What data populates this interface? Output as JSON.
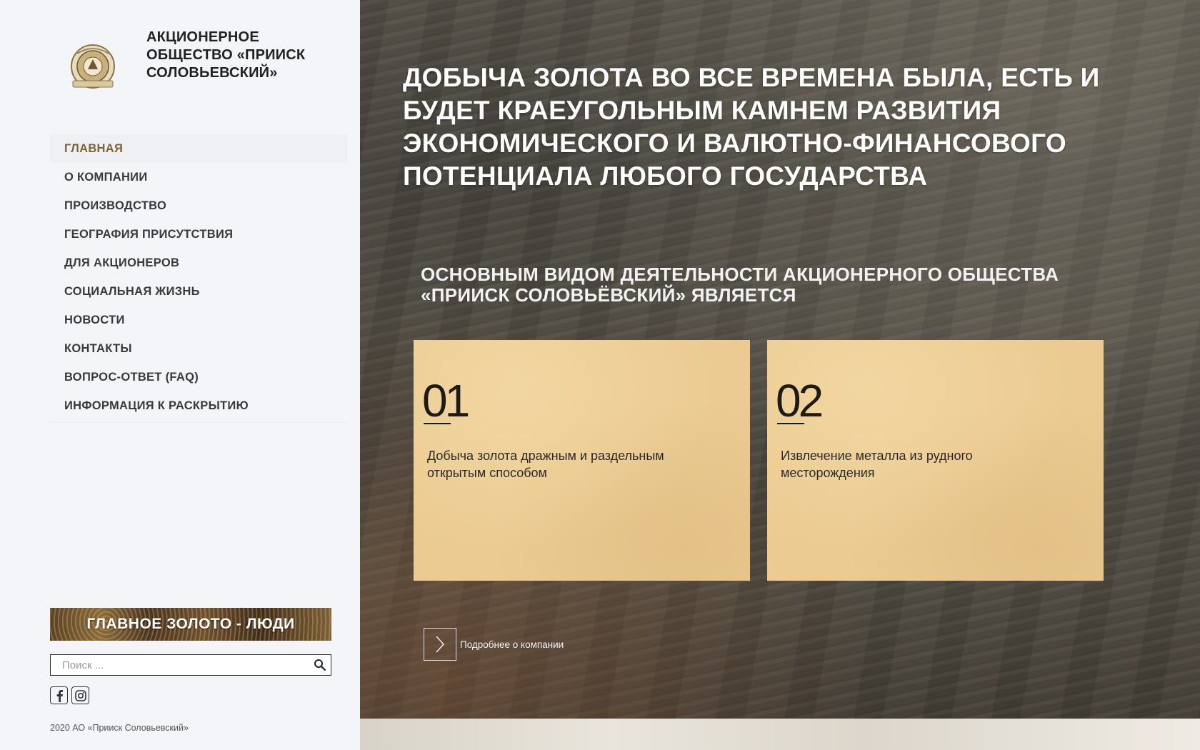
{
  "brand": {
    "title": "АКЦИОНЕРНОЕ ОБЩЕСТВО «ПРИИСК СОЛОВЬЕВСКИЙ»",
    "logo_icon": "company-emblem-icon"
  },
  "nav": {
    "items": [
      {
        "label": "ГЛАВНАЯ",
        "active": true
      },
      {
        "label": "О КОМПАНИИ"
      },
      {
        "label": "ПРОИЗВОДСТВО"
      },
      {
        "label": "ГЕОГРАФИЯ ПРИСУТСТВИЯ"
      },
      {
        "label": "ДЛЯ АКЦИОНЕРОВ"
      },
      {
        "label": "СОЦИАЛЬНАЯ ЖИЗНЬ"
      },
      {
        "label": "НОВОСТИ"
      },
      {
        "label": "КОНТАКТЫ"
      },
      {
        "label": "ВОПРОС-ОТВЕТ (FAQ)"
      },
      {
        "label": "ИНФОРМАЦИЯ К РАСКРЫТИЮ"
      }
    ]
  },
  "banner": {
    "label": "ГЛАВНОЕ ЗОЛОТО - ЛЮДИ"
  },
  "search": {
    "placeholder": "Поиск ...",
    "value": "",
    "icon": "search-icon"
  },
  "socials": [
    {
      "name": "facebook",
      "icon": "facebook-icon"
    },
    {
      "name": "instagram",
      "icon": "instagram-icon"
    }
  ],
  "footer": {
    "copyright": "2020 АО «Прииск Соловьевский»"
  },
  "hero": {
    "heading": "ДОБЫЧА ЗОЛОТА ВО ВСЕ ВРЕМЕНА БЫЛА, ЕСТЬ И БУДЕТ КРАЕУГОЛЬНЫМ КАМНЕМ РАЗВИТИЯ ЭКОНОМИЧЕСКОГО И ВАЛЮТНО-ФИНАНСОВОГО ПОТЕНЦИАЛА ЛЮБОГО ГОСУДАРСТВА",
    "subheading": "ОСНОВНЫМ ВИДОМ ДЕЯТЕЛЬНОСТИ АКЦИОНЕРНОГО ОБЩЕСТВА «ПРИИСК СОЛОВЬЁВСКИЙ» ЯВЛЯЕТСЯ",
    "cards": [
      {
        "number": "01",
        "text": "Добыча золота дражным и раздельным открытым способом"
      },
      {
        "number": "02",
        "text": "Извлечение металла из рудного месторождения"
      }
    ],
    "more_label": "Подробнее о компании",
    "more_icon": "chevron-right-icon"
  },
  "colors": {
    "accent_gold": "#7c6438",
    "card_bg": "#ebcb92",
    "sidebar_bg": "#f4f5f9"
  }
}
